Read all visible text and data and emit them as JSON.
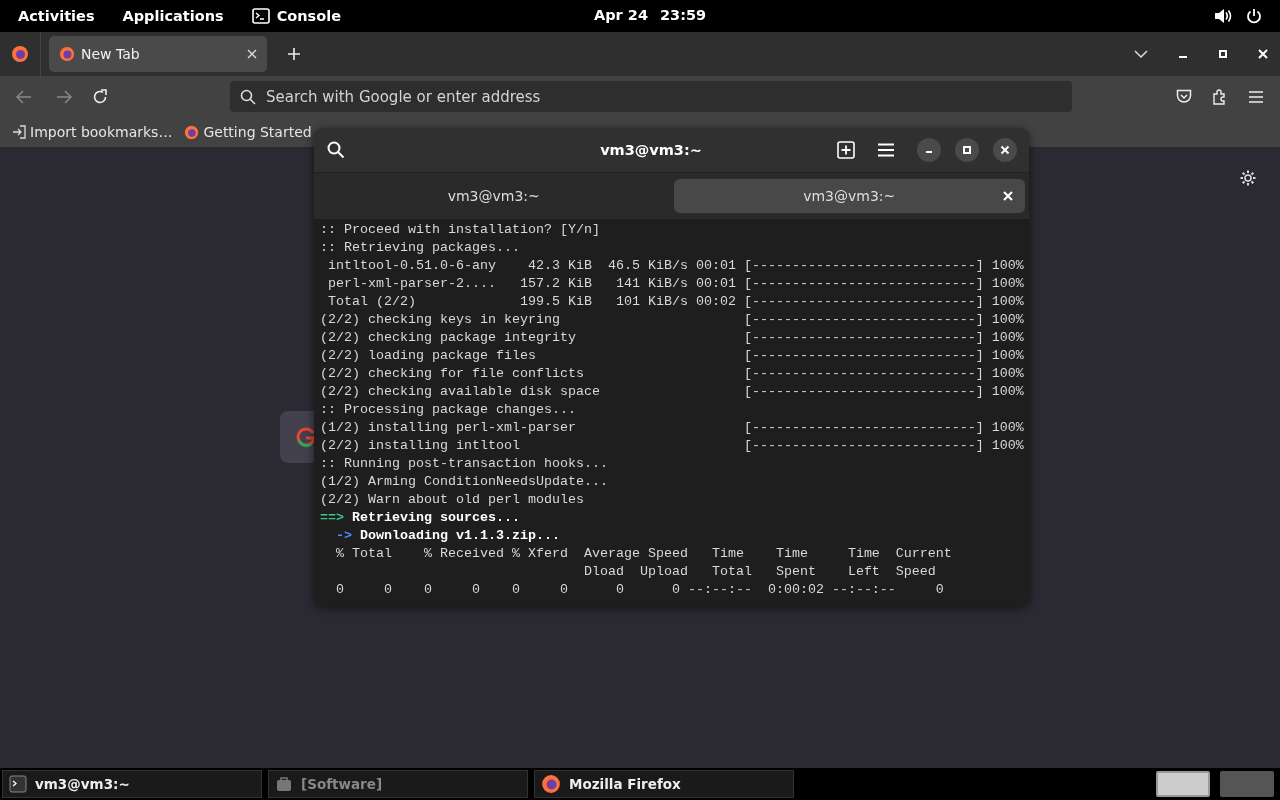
{
  "top_bar": {
    "activities": "Activities",
    "applications": "Applications",
    "app_menu": "Console",
    "date": "Apr 24",
    "time": "23:59"
  },
  "browser": {
    "tabs": [
      {
        "label": "New Tab",
        "selected": true
      }
    ],
    "address_bar": {
      "placeholder": "Search with Google or enter address"
    },
    "bookmarks": [
      {
        "kind": "import",
        "label": "Import bookmarks…"
      },
      {
        "kind": "site",
        "label": "Getting Started"
      }
    ]
  },
  "terminal": {
    "title": "vm3@vm3:~",
    "tabs": [
      {
        "label": "vm3@vm3:~",
        "selected": false
      },
      {
        "label": "vm3@vm3:~",
        "selected": true
      }
    ],
    "lines": [
      {
        "kind": "plain",
        "text": ":: Proceed with installation? [Y/n]"
      },
      {
        "kind": "plain",
        "text": ":: Retrieving packages..."
      },
      {
        "kind": "plain",
        "text": " intltool-0.51.0-6-any    42.3 KiB  46.5 KiB/s 00:01 [----------------------------] 100%"
      },
      {
        "kind": "plain",
        "text": " perl-xml-parser-2....   157.2 KiB   141 KiB/s 00:01 [----------------------------] 100%"
      },
      {
        "kind": "plain",
        "text": " Total (2/2)             199.5 KiB   101 KiB/s 00:02 [----------------------------] 100%"
      },
      {
        "kind": "plain",
        "text": "(2/2) checking keys in keyring                       [----------------------------] 100%"
      },
      {
        "kind": "plain",
        "text": "(2/2) checking package integrity                     [----------------------------] 100%"
      },
      {
        "kind": "plain",
        "text": "(2/2) loading package files                          [----------------------------] 100%"
      },
      {
        "kind": "plain",
        "text": "(2/2) checking for file conflicts                    [----------------------------] 100%"
      },
      {
        "kind": "plain",
        "text": "(2/2) checking available disk space                  [----------------------------] 100%"
      },
      {
        "kind": "plain",
        "text": ":: Processing package changes..."
      },
      {
        "kind": "plain",
        "text": "(1/2) installing perl-xml-parser                     [----------------------------] 100%"
      },
      {
        "kind": "plain",
        "text": "(2/2) installing intltool                            [----------------------------] 100%"
      },
      {
        "kind": "plain",
        "text": ":: Running post-transaction hooks..."
      },
      {
        "kind": "plain",
        "text": "(1/2) Arming ConditionNeedsUpdate..."
      },
      {
        "kind": "plain",
        "text": "(2/2) Warn about old perl modules"
      },
      {
        "kind": "step",
        "arrow": "==>",
        "text": "Retrieving sources..."
      },
      {
        "kind": "substep",
        "arrow": "->",
        "text": "Downloading v1.1.3.zip..."
      },
      {
        "kind": "plain",
        "text": "  % Total    % Received % Xferd  Average Speed   Time    Time     Time  Current"
      },
      {
        "kind": "plain",
        "text": "                                 Dload  Upload   Total   Spent    Left  Speed"
      },
      {
        "kind": "plain",
        "text": "  0     0    0     0    0     0      0      0 --:--:--  0:00:02 --:--:--     0"
      }
    ]
  },
  "taskbar": {
    "items": [
      {
        "kind": "terminal",
        "label": "vm3@vm3:~",
        "minimized": false
      },
      {
        "kind": "software",
        "label": "[Software]",
        "minimized": true
      },
      {
        "kind": "browser",
        "label": "Mozilla Firefox",
        "minimized": false
      }
    ],
    "workspaces": [
      {
        "selected": true
      },
      {
        "selected": false
      }
    ]
  }
}
